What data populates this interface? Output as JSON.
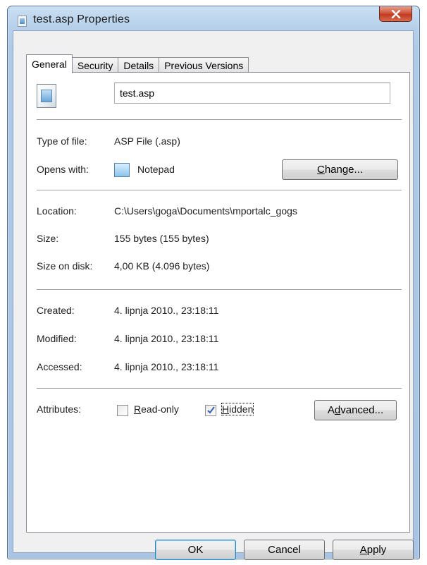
{
  "window": {
    "title": "test.asp Properties",
    "close_label": "X"
  },
  "tabs": [
    "General",
    "Security",
    "Details",
    "Previous Versions"
  ],
  "general": {
    "file_name": "test.asp",
    "type_label": "Type of file:",
    "type_value": "ASP File (.asp)",
    "opens_label": "Opens with:",
    "opens_value": "Notepad",
    "change_button": {
      "pre": "",
      "accel": "C",
      "post": "hange..."
    },
    "location_label": "Location:",
    "location_value": "C:\\Users\\goga\\Documents\\mportalc_gogs",
    "size_label": "Size:",
    "size_value": "155 bytes (155 bytes)",
    "size_disk_label": "Size on disk:",
    "size_disk_value": "4,00 KB (4.096 bytes)",
    "created_label": "Created:",
    "created_value": "4. lipnja 2010., 23:18:11",
    "modified_label": "Modified:",
    "modified_value": "4. lipnja 2010., 23:18:11",
    "accessed_label": "Accessed:",
    "accessed_value": "4. lipnja 2010., 23:18:11",
    "attributes_label": "Attributes:",
    "readonly": {
      "accel": "R",
      "rest": "ead-only",
      "checked": false
    },
    "hidden": {
      "accel": "H",
      "rest": "idden",
      "checked": true
    },
    "advanced_button": {
      "pre": "A",
      "accel": "d",
      "post": "vanced..."
    }
  },
  "footer": {
    "ok": "OK",
    "cancel": "Cancel",
    "apply": {
      "accel": "A",
      "rest": "pply"
    }
  },
  "icons": [
    "file-icon",
    "close-icon",
    "notepad-icon",
    "checkmark-icon"
  ]
}
